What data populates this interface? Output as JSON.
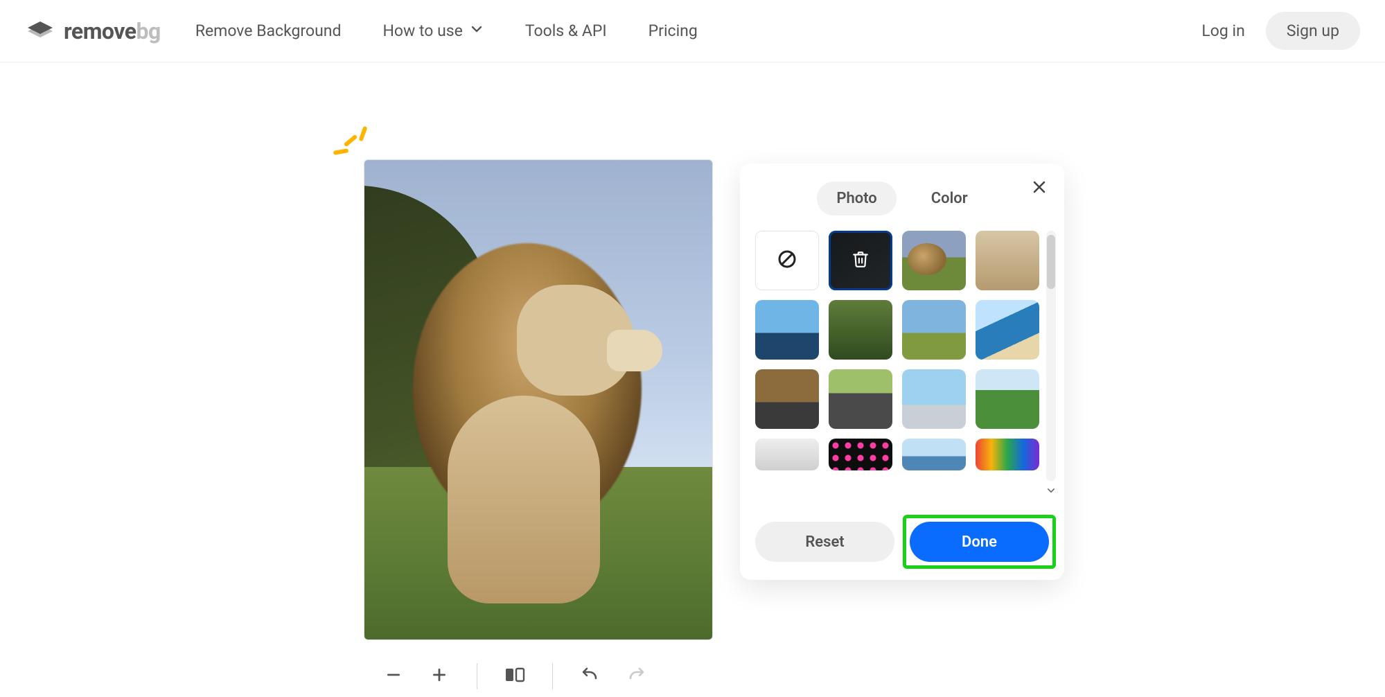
{
  "brand": {
    "name_a": "remove",
    "name_b": "bg"
  },
  "nav": {
    "remove_background": "Remove Background",
    "how_to_use": "How to use",
    "tools_api": "Tools & API",
    "pricing": "Pricing"
  },
  "auth": {
    "login": "Log in",
    "signup": "Sign up"
  },
  "panel": {
    "tabs": {
      "photo": "Photo",
      "color": "Color",
      "active": "photo"
    },
    "actions": {
      "reset": "Reset",
      "done": "Done"
    },
    "thumbs": [
      {
        "id": "none",
        "kind": "none"
      },
      {
        "id": "current",
        "kind": "dark",
        "selected": true
      },
      {
        "id": "lion",
        "kind": "lion"
      },
      {
        "id": "patio",
        "kind": "patio"
      },
      {
        "id": "lake",
        "kind": "lake"
      },
      {
        "id": "jungle",
        "kind": "jungle"
      },
      {
        "id": "coast",
        "kind": "coast"
      },
      {
        "id": "beach",
        "kind": "beach"
      },
      {
        "id": "road1",
        "kind": "road1"
      },
      {
        "id": "road2",
        "kind": "road2"
      },
      {
        "id": "city",
        "kind": "city"
      },
      {
        "id": "hills",
        "kind": "hills"
      },
      {
        "id": "hall",
        "kind": "hall",
        "partial": true
      },
      {
        "id": "dots",
        "kind": "dots",
        "partial": true
      },
      {
        "id": "sea",
        "kind": "sea",
        "partial": true
      },
      {
        "id": "rainbow",
        "kind": "rainbow",
        "partial": true
      }
    ]
  },
  "toolbar": {
    "zoom_out": "zoom-out",
    "zoom_in": "zoom-in",
    "compare": "compare",
    "undo": "undo",
    "redo": "redo",
    "redo_enabled": false
  }
}
